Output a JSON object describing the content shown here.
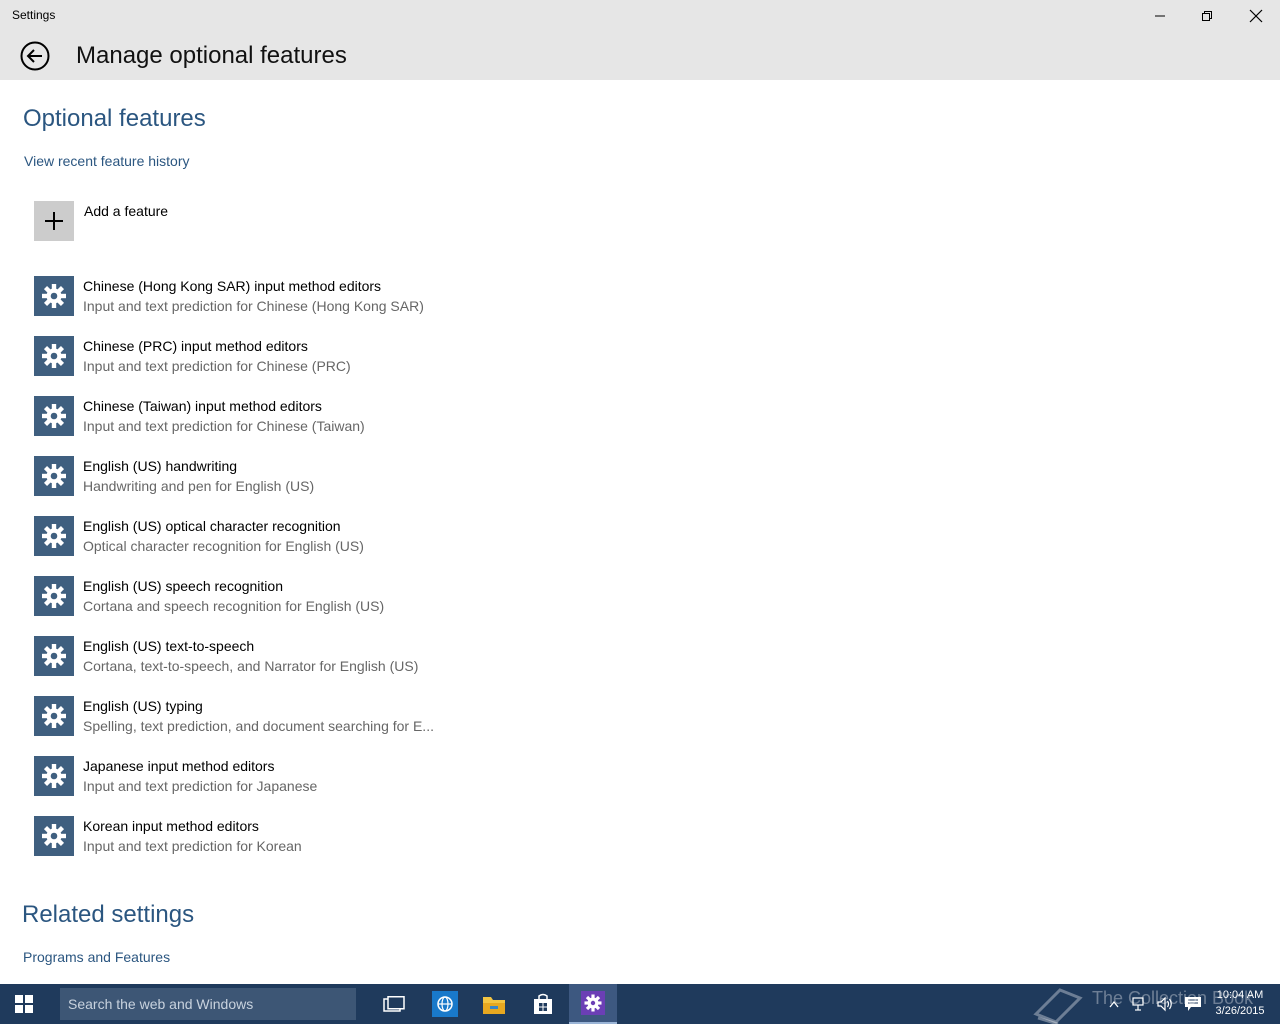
{
  "window": {
    "title": "Settings"
  },
  "header": {
    "title": "Manage optional features"
  },
  "optional_features": {
    "heading": "Optional features",
    "history_link": "View recent feature history",
    "add_label": "Add a feature",
    "items": [
      {
        "name": "Chinese (Hong Kong SAR) input method editors",
        "desc": "Input and text prediction for Chinese (Hong Kong SAR)"
      },
      {
        "name": "Chinese (PRC) input method editors",
        "desc": "Input and text prediction for Chinese (PRC)"
      },
      {
        "name": "Chinese (Taiwan) input method editors",
        "desc": "Input and text prediction for Chinese (Taiwan)"
      },
      {
        "name": "English (US) handwriting",
        "desc": "Handwriting and pen for English (US)"
      },
      {
        "name": "English (US) optical character recognition",
        "desc": "Optical character recognition for English (US)"
      },
      {
        "name": "English (US) speech recognition",
        "desc": "Cortana and speech recognition for English (US)"
      },
      {
        "name": "English (US) text-to-speech",
        "desc": "Cortana, text-to-speech, and Narrator for English (US)"
      },
      {
        "name": "English (US) typing",
        "desc": "Spelling, text prediction, and document searching for E..."
      },
      {
        "name": "Japanese input method editors",
        "desc": "Input and text prediction for Japanese"
      },
      {
        "name": "Korean input method editors",
        "desc": "Input and text prediction for Korean"
      }
    ]
  },
  "related": {
    "heading": "Related settings",
    "programs_link": "Programs and Features"
  },
  "taskbar": {
    "search_placeholder": "Search the web and Windows",
    "time": "10:04 AM",
    "date": "3/26/2015",
    "watermark": "The Collection Book"
  },
  "colors": {
    "accent": "#2b5680",
    "gear_tile": "#3f5f7f",
    "taskbar": "#1f3a5c"
  }
}
